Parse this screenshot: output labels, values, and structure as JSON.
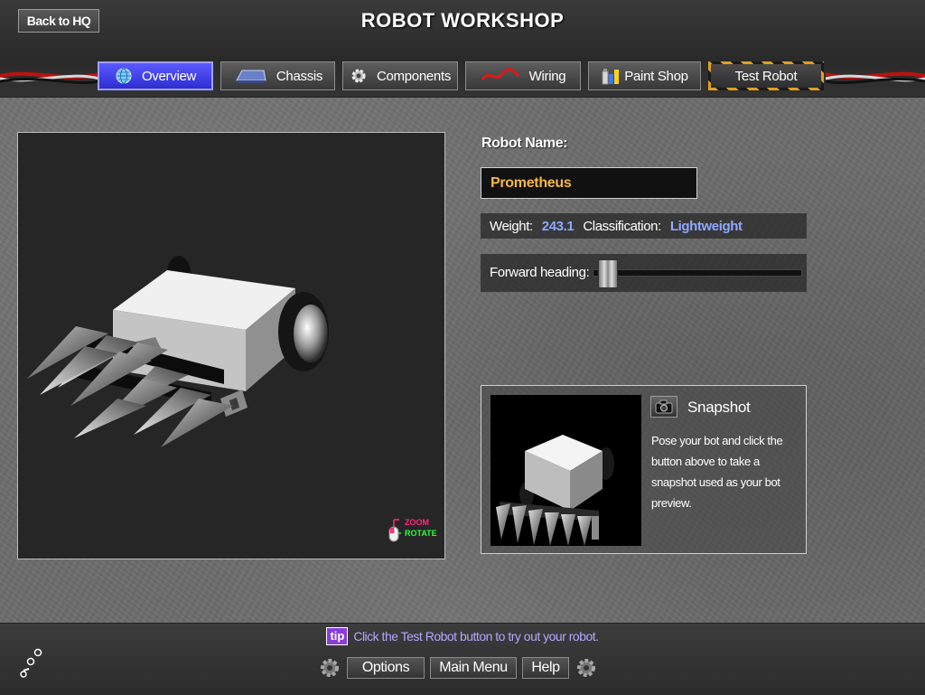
{
  "header": {
    "back_label": "Back to HQ",
    "title": "ROBOT WORKSHOP"
  },
  "tabs": [
    {
      "label": "Overview",
      "icon": "globe-icon",
      "active": true
    },
    {
      "label": "Chassis",
      "icon": "chassis-icon",
      "active": false
    },
    {
      "label": "Components",
      "icon": "gear-icon",
      "active": false
    },
    {
      "label": "Wiring",
      "icon": "wire-icon",
      "active": false
    },
    {
      "label": "Paint Shop",
      "icon": "paint-icon",
      "active": false
    },
    {
      "label": "Test Robot",
      "icon": "",
      "active": false
    }
  ],
  "viewport": {
    "zoom_label": "ZOOM",
    "rotate_label": "ROTATE"
  },
  "robot": {
    "name_label": "Robot Name:",
    "name_value": "Prometheus",
    "weight_label": "Weight:",
    "weight_value": "243.1",
    "classification_label": "Classification:",
    "classification_value": "Lightweight",
    "heading_label": "Forward heading:",
    "heading_fraction": 0.03
  },
  "snapshot": {
    "title": "Snapshot",
    "description": "Pose your bot and click the button above to take a snapshot used as your bot preview."
  },
  "footer": {
    "tip_badge": "tip",
    "tip_text": "Click the Test Robot button to try out your robot.",
    "options_label": "Options",
    "main_menu_label": "Main Menu",
    "help_label": "Help"
  },
  "colors": {
    "accent_tab": "#3d3dea",
    "name_text": "#f5b942",
    "stat_value": "#8fa8ff",
    "tip_text": "#b2a8ff",
    "tip_badge": "#8a3dd8",
    "zoom": "#ff2a7a",
    "rotate": "#2aff3a"
  }
}
